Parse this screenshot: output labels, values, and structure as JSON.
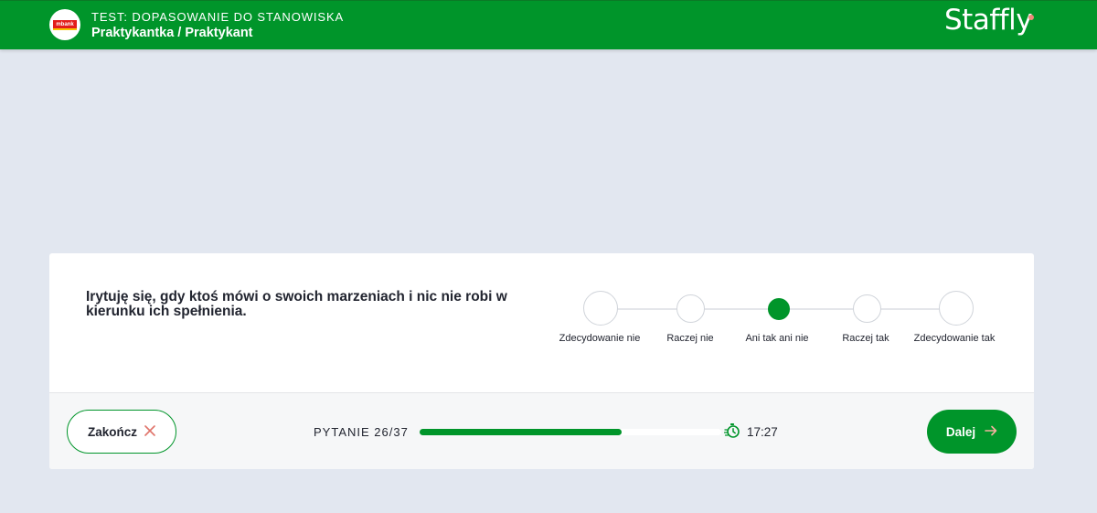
{
  "header": {
    "company_logo_text": "mbank",
    "test_label": "TEST: DOPASOWANIE DO STANOWISKA",
    "position_title": "Praktykantka / Praktykant",
    "brand_name": "Staffly"
  },
  "question": {
    "text": "Irytuję się, gdy ktoś mówi o swoich marzeniach i nic nie robi w kierunku ich spełnienia."
  },
  "scale": {
    "options": [
      {
        "label": "Zdecydowanie nie",
        "selected": false
      },
      {
        "label": "Raczej nie",
        "selected": false
      },
      {
        "label": "Ani tak ani nie",
        "selected": true
      },
      {
        "label": "Raczej tak",
        "selected": false
      },
      {
        "label": "Zdecydowanie tak",
        "selected": false
      }
    ]
  },
  "footer": {
    "end_label": "Zakończ",
    "end_icon": "close-x-icon",
    "progress_text": "PYTANIE 26/37",
    "progress_current": 26,
    "progress_total": 37,
    "progress_fraction": 0.67,
    "timer_icon": "stopwatch-icon",
    "timer": "17:27",
    "next_label": "Dalej",
    "next_icon": "arrow-right-icon"
  },
  "colors": {
    "brand_green": "#00952a",
    "background": "#e2e7f0",
    "accent_coral": "#f08a7a"
  }
}
